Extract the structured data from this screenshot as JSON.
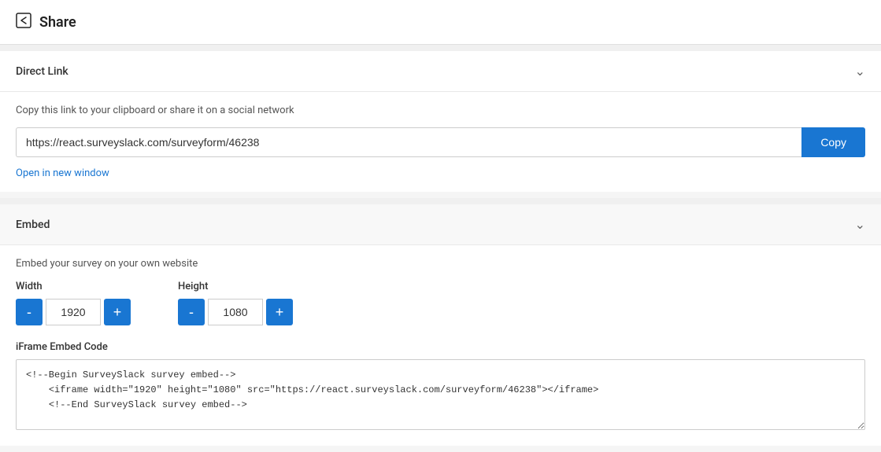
{
  "header": {
    "title": "Share",
    "icon": "share-icon"
  },
  "direct_link_section": {
    "title": "Direct Link",
    "description": "Copy this link to your clipboard or share it on a social network",
    "url": "https://react.surveyslack.com/surveyform/46238",
    "url_placeholder": "https://react.surveyslack.com/surveyform/46238",
    "copy_button_label": "Copy",
    "open_new_window_label": "Open in new window"
  },
  "embed_section": {
    "title": "Embed",
    "description": "Embed your survey on your own website",
    "width_label": "Width",
    "width_value": "1920",
    "height_label": "Height",
    "height_value": "1080",
    "minus_label": "-",
    "plus_label": "+",
    "iframe_code_label": "iFrame Embed Code",
    "iframe_code": "<!--Begin SurveySla ck survey embed-->\n    <iframe width=\"1920\" height=\"1080\" src=\"https://react.surveyslack.com/surveyform/46238\"></iframe>\n    <!--End SurveySlack survey embed-->"
  }
}
